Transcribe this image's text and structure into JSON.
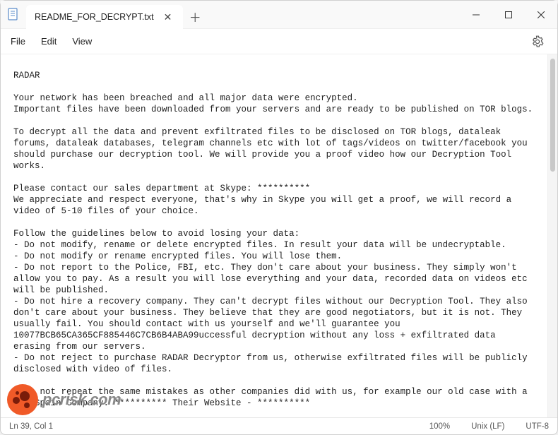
{
  "tab": {
    "title": "README_FOR_DECRYPT.txt"
  },
  "menu": {
    "file": "File",
    "edit": "Edit",
    "view": "View"
  },
  "body": {
    "title": "RADAR",
    "p1": "Your network has been breached and all major data were encrypted.\nImportant files have been downloaded from your servers and are ready to be published on TOR blogs.",
    "p2": "To decrypt all the data and prevent exfiltrated files to be disclosed on TOR blogs, dataleak forums, dataleak databases, telegram channels etc with lot of tags/videos on twitter/facebook you should purchase our decryption tool. We will provide you a proof video how our Decryption Tool works.",
    "p3": "Please contact our sales department at Skype: **********\nWe appreciate and respect everyone, that's why in Skype you will get a proof, we will record a video of 5-10 files of your choice.",
    "p4": "Follow the guidelines below to avoid losing your data:",
    "b1": "- Do not modify, rename or delete encrypted files. In result your data will be undecryptable.",
    "b2": "- Do not modify or rename encrypted files. You will lose them.",
    "b3": "- Do not report to the Police, FBI, etc. They don't care about your business. They simply won't allow you to pay. As a result you will lose everything and your data, recorded data on videos etc will be published.",
    "b4": "- Do not hire a recovery company. They can't decrypt files without our Decryption Tool. They also don't care about your business. They believe that they are good negotiators, but it is not. They usually fail. You should contact with us yourself and we'll guarantee you 10077BCB65CA365CF885446C7CB6B4ABA99uccessful decryption without any loss + exfiltrated data erasing from our servers.",
    "b5": "- Do not reject to purchase RADAR Decryptor from us, otherwise exfiltrated files will be publicly disclosed with video of files.",
    "p5": "- Do not repeat the same mistakes as other companies did with us, for example our old case with a big Spain Company: ********** Their Website - **********"
  },
  "status": {
    "pos": "Ln 39, Col 1",
    "zoom": "100%",
    "eol": "Unix (LF)",
    "enc": "UTF-8"
  },
  "watermark": {
    "text": "pcrisk.com"
  }
}
